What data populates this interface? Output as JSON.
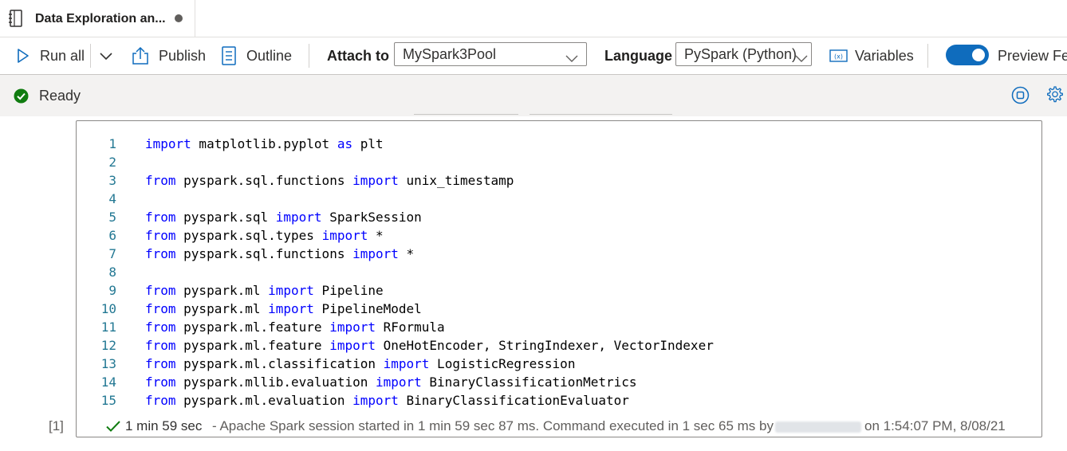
{
  "tab": {
    "title": "Data Exploration an..."
  },
  "toolbar": {
    "run_all": "Run all",
    "publish": "Publish",
    "outline": "Outline",
    "attach_to_label": "Attach to",
    "attach_to_value": "MySpark3Pool",
    "language_label": "Language",
    "language_value": "PySpark (Python)",
    "variables": "Variables",
    "preview_features": "Preview Fea",
    "preview_toggle_on": true
  },
  "status": {
    "text": "Ready"
  },
  "cell": {
    "exec_count": "[1]",
    "duration": "1 min 59 sec",
    "message": "- Apache Spark session started in 1 min 59 sec 87 ms. Command executed in 1 sec 65 ms by",
    "timestamp": "on 1:54:07 PM, 8/08/21",
    "lines": [
      {
        "n": "1",
        "tokens": [
          {
            "k": "kw",
            "t": "import"
          },
          {
            "k": "",
            "t": " matplotlib.pyplot "
          },
          {
            "k": "kw",
            "t": "as"
          },
          {
            "k": "",
            "t": " plt"
          }
        ]
      },
      {
        "n": "2",
        "tokens": []
      },
      {
        "n": "3",
        "tokens": [
          {
            "k": "kw",
            "t": "from"
          },
          {
            "k": "",
            "t": " pyspark.sql.functions "
          },
          {
            "k": "kw",
            "t": "import"
          },
          {
            "k": "",
            "t": " unix_timestamp"
          }
        ]
      },
      {
        "n": "4",
        "tokens": []
      },
      {
        "n": "5",
        "tokens": [
          {
            "k": "kw",
            "t": "from"
          },
          {
            "k": "",
            "t": " pyspark.sql "
          },
          {
            "k": "kw",
            "t": "import"
          },
          {
            "k": "",
            "t": " SparkSession"
          }
        ]
      },
      {
        "n": "6",
        "tokens": [
          {
            "k": "kw",
            "t": "from"
          },
          {
            "k": "",
            "t": " pyspark.sql.types "
          },
          {
            "k": "kw",
            "t": "import"
          },
          {
            "k": "",
            "t": " *"
          }
        ]
      },
      {
        "n": "7",
        "tokens": [
          {
            "k": "kw",
            "t": "from"
          },
          {
            "k": "",
            "t": " pyspark.sql.functions "
          },
          {
            "k": "kw",
            "t": "import"
          },
          {
            "k": "",
            "t": " *"
          }
        ]
      },
      {
        "n": "8",
        "tokens": []
      },
      {
        "n": "9",
        "tokens": [
          {
            "k": "kw",
            "t": "from"
          },
          {
            "k": "",
            "t": " pyspark.ml "
          },
          {
            "k": "kw",
            "t": "import"
          },
          {
            "k": "",
            "t": " Pipeline"
          }
        ]
      },
      {
        "n": "10",
        "tokens": [
          {
            "k": "kw",
            "t": "from"
          },
          {
            "k": "",
            "t": " pyspark.ml "
          },
          {
            "k": "kw",
            "t": "import"
          },
          {
            "k": "",
            "t": " PipelineModel"
          }
        ]
      },
      {
        "n": "11",
        "tokens": [
          {
            "k": "kw",
            "t": "from"
          },
          {
            "k": "",
            "t": " pyspark.ml.feature "
          },
          {
            "k": "kw",
            "t": "import"
          },
          {
            "k": "",
            "t": " RFormula"
          }
        ]
      },
      {
        "n": "12",
        "tokens": [
          {
            "k": "kw",
            "t": "from"
          },
          {
            "k": "",
            "t": " pyspark.ml.feature "
          },
          {
            "k": "kw",
            "t": "import"
          },
          {
            "k": "",
            "t": " OneHotEncoder, StringIndexer, VectorIndexer"
          }
        ]
      },
      {
        "n": "13",
        "tokens": [
          {
            "k": "kw",
            "t": "from"
          },
          {
            "k": "",
            "t": " pyspark.ml.classification "
          },
          {
            "k": "kw",
            "t": "import"
          },
          {
            "k": "",
            "t": " LogisticRegression"
          }
        ]
      },
      {
        "n": "14",
        "tokens": [
          {
            "k": "kw",
            "t": "from"
          },
          {
            "k": "",
            "t": " pyspark.mllib.evaluation "
          },
          {
            "k": "kw",
            "t": "import"
          },
          {
            "k": "",
            "t": " BinaryClassificationMetrics"
          }
        ]
      },
      {
        "n": "15",
        "tokens": [
          {
            "k": "kw",
            "t": "from"
          },
          {
            "k": "",
            "t": " pyspark.ml.evaluation "
          },
          {
            "k": "kw",
            "t": "import"
          },
          {
            "k": "",
            "t": " BinaryClassificationEvaluator"
          }
        ]
      }
    ]
  },
  "icons": {
    "notebook": "notebook-icon",
    "run": "play-icon",
    "dropdown": "chevron-down-icon",
    "publish": "upload-icon",
    "outline": "document-icon",
    "variables": "variables-icon",
    "ready": "check-circle-icon",
    "stop": "stop-session-icon",
    "settings": "gear-icon",
    "success": "checkmark-icon"
  },
  "colors": {
    "accent": "#0f6cbd",
    "keyword": "#0000ff",
    "line_number": "#237893",
    "success": "#107c10"
  }
}
